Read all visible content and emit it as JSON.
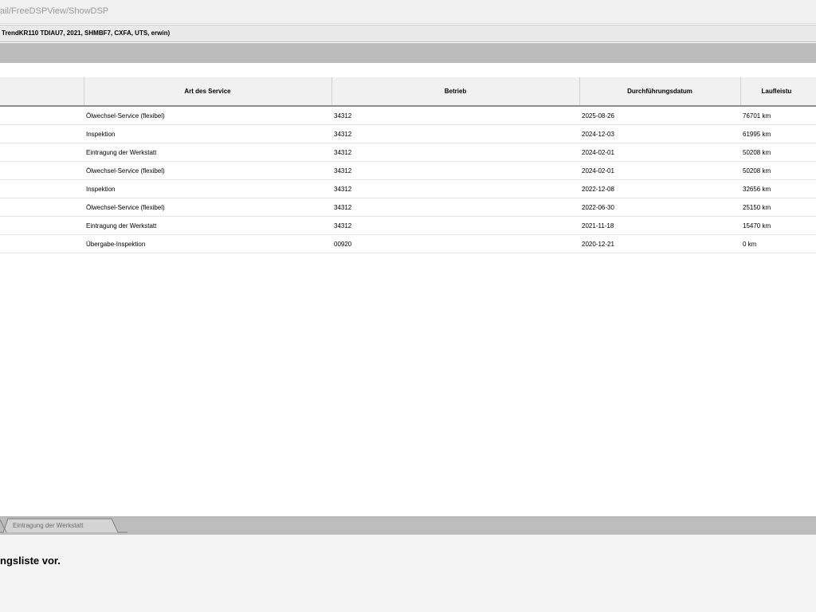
{
  "browser": {
    "url": "ail/FreeDSPView/ShowDSP"
  },
  "vehicle": {
    "info": "TrendKR110 TDIAU7, 2021, SHMBF7, CXFA, UTS, erwin)"
  },
  "table": {
    "columns": [
      "",
      "Art des Service",
      "Betrieb",
      "Durchführungsdatum",
      "Laufleistu"
    ],
    "rows": [
      [
        "",
        "Ölwechsel-Service (flexibel)",
        "34312",
        "2025-08-26",
        "76701 km"
      ],
      [
        "",
        "Inspektion",
        "34312",
        "2024-12-03",
        "61995 km"
      ],
      [
        "",
        "Eintragung der Werkstatt",
        "34312",
        "2024-02-01",
        "50208 km"
      ],
      [
        "",
        "Ölwechsel-Service (flexibel)",
        "34312",
        "2024-02-01",
        "50208 km"
      ],
      [
        "",
        "Inspektion",
        "34312",
        "2022-12-08",
        "32656 km"
      ],
      [
        "",
        "Ölwechsel-Service (flexibel)",
        "34312",
        "2022-06-30",
        "25150 km"
      ],
      [
        "",
        "Eintragung der Werkstatt",
        "34312",
        "2021-11-18",
        "15470 km"
      ],
      [
        "",
        "Übergabe-Inspektion",
        "00920",
        "2020-12-21",
        "0 km"
      ]
    ]
  },
  "tabs": {
    "active_label": "Eintragung der Werkstatt"
  },
  "footer": {
    "message": "ngsliste vor."
  }
}
